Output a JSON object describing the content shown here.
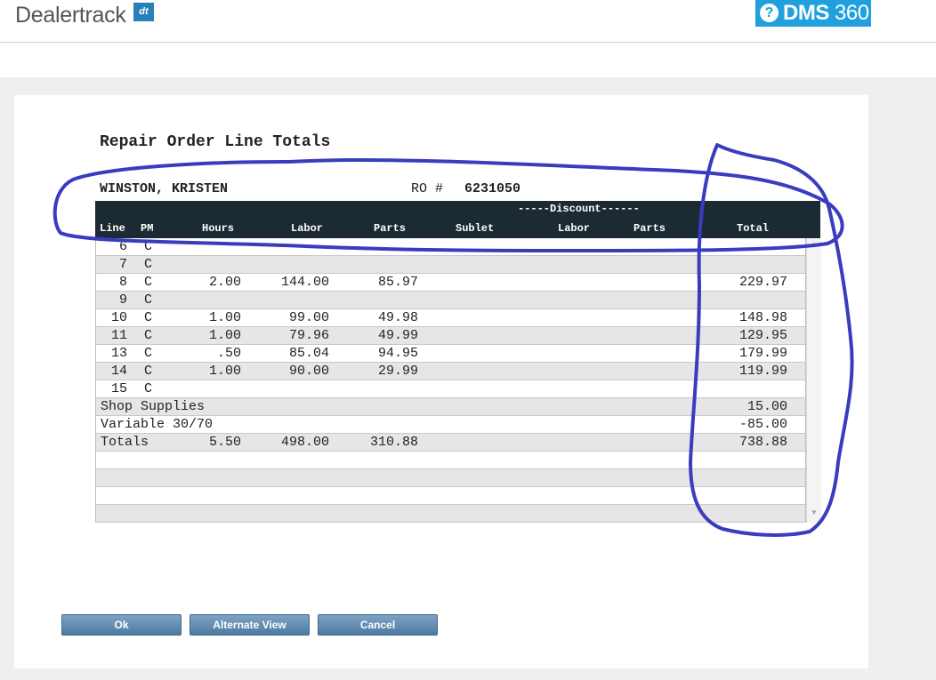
{
  "header": {
    "brand": "Dealertrack",
    "brand_mark": "dt",
    "product": "DMS",
    "product_version": "360",
    "help_icon": "question-circle-icon",
    "colors": {
      "brand_mark": "#2a7fb8",
      "product_badge": "#20a0dc"
    }
  },
  "page": {
    "title": "Repair Order Line Totals",
    "customer_name": "WINSTON, KRISTEN",
    "ro_label": "RO #",
    "ro_number": "6231050"
  },
  "table": {
    "discount_group": "-----Discount------",
    "headers": {
      "line": "Line",
      "pm": "PM",
      "hours": "Hours",
      "labor": "Labor",
      "parts": "Parts",
      "sublet": "Sublet",
      "disc_labor": "Labor",
      "disc_parts": "Parts",
      "total": "Total"
    },
    "rows": [
      {
        "line": "6",
        "pm": "C",
        "hours": "",
        "labor": "",
        "parts": "",
        "total": ""
      },
      {
        "line": "7",
        "pm": "C",
        "hours": "",
        "labor": "",
        "parts": "",
        "total": ""
      },
      {
        "line": "8",
        "pm": "C",
        "hours": "2.00",
        "labor": "144.00",
        "parts": "85.97",
        "total": "229.97"
      },
      {
        "line": "9",
        "pm": "C",
        "hours": "",
        "labor": "",
        "parts": "",
        "total": ""
      },
      {
        "line": "10",
        "pm": "C",
        "hours": "1.00",
        "labor": "99.00",
        "parts": "49.98",
        "total": "148.98"
      },
      {
        "line": "11",
        "pm": "C",
        "hours": "1.00",
        "labor": "79.96",
        "parts": "49.99",
        "total": "129.95"
      },
      {
        "line": "13",
        "pm": "C",
        "hours": ".50",
        "labor": "85.04",
        "parts": "94.95",
        "total": "179.99"
      },
      {
        "line": "14",
        "pm": "C",
        "hours": "1.00",
        "labor": "90.00",
        "parts": "29.99",
        "total": "119.99"
      },
      {
        "line": "15",
        "pm": "C",
        "hours": "",
        "labor": "",
        "parts": "",
        "total": ""
      }
    ],
    "summary": [
      {
        "label": "Shop Supplies",
        "hours": "",
        "labor": "",
        "parts": "",
        "total": "15.00"
      },
      {
        "label": "Variable 30/70",
        "hours": "",
        "labor": "",
        "parts": "",
        "total": "-85.00"
      },
      {
        "label": "Totals",
        "hours": "5.50",
        "labor": "498.00",
        "parts": "310.88",
        "total": "738.88"
      }
    ],
    "empty_rows": 4
  },
  "buttons": {
    "ok": "Ok",
    "alternate_view": "Alternate View",
    "cancel": "Cancel"
  },
  "annotation": {
    "color": "#3a3cc0"
  }
}
